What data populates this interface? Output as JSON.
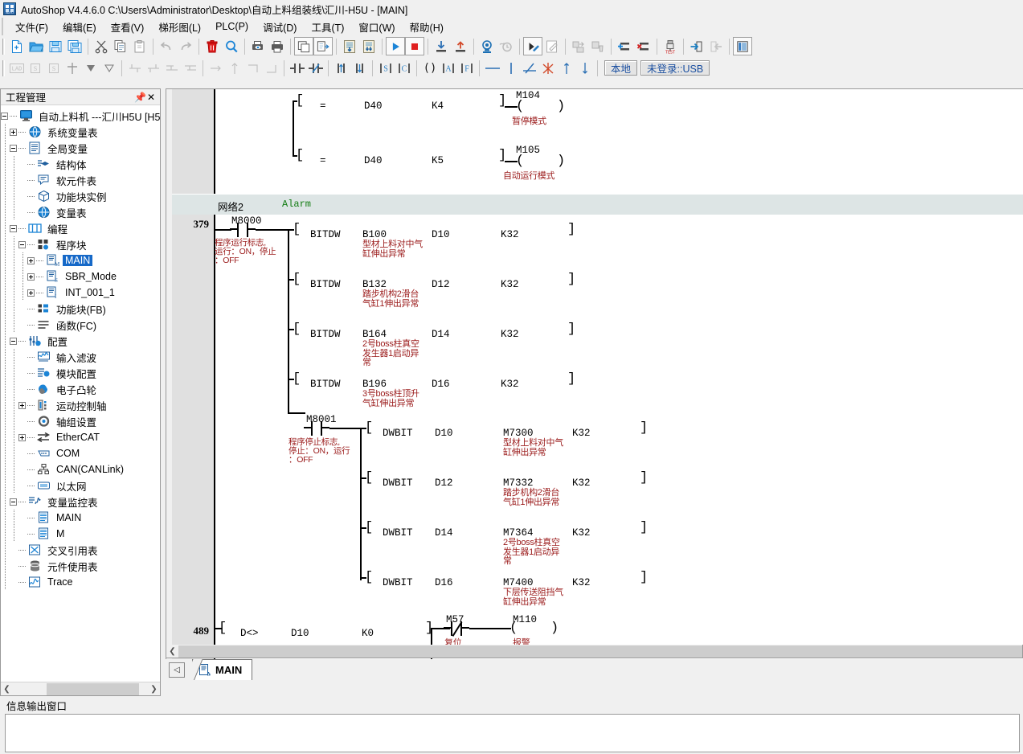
{
  "window": {
    "app_name": "AutoShop V4.4.6.0",
    "path": "C:\\Users\\Administrator\\Desktop\\自动上料组装线\\汇川-H5U - [MAIN]",
    "title": "AutoShop V4.4.6.0  C:\\Users\\Administrator\\Desktop\\自动上料组装线\\汇川-H5U - [MAIN]",
    "icon": "autoshop-logo"
  },
  "menubar": {
    "items": [
      {
        "label": "文件(F)"
      },
      {
        "label": "编辑(E)"
      },
      {
        "label": "查看(V)"
      },
      {
        "label": "梯形图(L)"
      },
      {
        "label": "PLC(P)"
      },
      {
        "label": "调试(D)"
      },
      {
        "label": "工具(T)"
      },
      {
        "label": "窗口(W)"
      },
      {
        "label": "帮助(H)"
      }
    ]
  },
  "toolbar_main": {
    "icons": [
      "new-file-icon",
      "open-folder-icon",
      "save-icon",
      "save-all-icon",
      "cut-icon",
      "copy-icon",
      "paste-icon",
      "undo-icon",
      "redo-icon",
      "delete-icon",
      "find-icon",
      "print-preview-icon",
      "print-icon",
      "compile-icon",
      "compile-all-icon",
      "download-to-plc-icon",
      "upload-from-plc-icon",
      "run-icon",
      "stop-icon",
      "download-icon",
      "upload-icon",
      "monitor-icon",
      "monitor-clock-icon",
      "edit-monitor-icon",
      "write-edit-icon",
      "force-icon",
      "force-clear-icon",
      "insert-row-icon",
      "delete-row-icon",
      "test-usb-icon",
      "login-icon",
      "logout-icon",
      "panel-icon"
    ]
  },
  "toolbar_ladder": {
    "icons": [
      "lad-icon",
      "stl-icon",
      "sfc-icon",
      "cursor-icon",
      "down-arrow-icon",
      "down-triangle-icon",
      "branch-up-icon",
      "branch-down-icon",
      "branch-left-icon",
      "branch-right-icon",
      "line-right-icon",
      "line-up-icon",
      "corner-icon",
      "corner2-icon",
      "no-contact-icon",
      "nc-contact-icon",
      "rising-edge-icon",
      "falling-edge-icon",
      "set-icon",
      "reset-icon",
      "coil-icon",
      "application-instruction-icon",
      "function-icon",
      "hline-icon",
      "vline-icon",
      "del-hline-icon",
      "del-vline-icon",
      "up-icon",
      "down-icon"
    ],
    "status_local": "本地",
    "status_login": "未登录::USB"
  },
  "project_panel": {
    "title": "工程管理",
    "pin_icon": "pin-icon",
    "close_icon": "close-icon",
    "tree": [
      {
        "label": "自动上料机 ---汇川H5U [H5",
        "icon": "plc-device-icon",
        "indent": 0,
        "toggle": "minus"
      },
      {
        "label": "系统变量表",
        "icon": "globe-icon",
        "indent": 1,
        "toggle": "plus"
      },
      {
        "label": "全局变量",
        "icon": "list-icon",
        "indent": 1,
        "toggle": "minus"
      },
      {
        "label": "结构体",
        "icon": "struct-icon",
        "indent": 2,
        "toggle": "none"
      },
      {
        "label": "软元件表",
        "icon": "device-table-icon",
        "indent": 2,
        "toggle": "none"
      },
      {
        "label": "功能块实例",
        "icon": "cube-icon",
        "indent": 2,
        "toggle": "none"
      },
      {
        "label": "变量表",
        "icon": "globe-icon",
        "indent": 2,
        "toggle": "none"
      },
      {
        "label": "编程",
        "icon": "contact-icon",
        "indent": 1,
        "toggle": "minus"
      },
      {
        "label": "程序块",
        "icon": "blocks-icon",
        "indent": 2,
        "toggle": "minus"
      },
      {
        "label": "MAIN",
        "icon": "main-prog-icon",
        "indent": 3,
        "toggle": "plus",
        "selected": true
      },
      {
        "label": "SBR_Mode",
        "icon": "sbr-prog-icon",
        "indent": 3,
        "toggle": "plus"
      },
      {
        "label": "INT_001_1",
        "icon": "int-prog-icon",
        "indent": 3,
        "toggle": "plus"
      },
      {
        "label": "功能块(FB)",
        "icon": "fb-icon",
        "indent": 2,
        "toggle": "none"
      },
      {
        "label": "函数(FC)",
        "icon": "fc-icon",
        "indent": 2,
        "toggle": "none"
      },
      {
        "label": "配置",
        "icon": "config-icon",
        "indent": 1,
        "toggle": "minus"
      },
      {
        "label": "输入滤波",
        "icon": "input-filter-icon",
        "indent": 2,
        "toggle": "none"
      },
      {
        "label": "模块配置",
        "icon": "module-config-icon",
        "indent": 2,
        "toggle": "none"
      },
      {
        "label": "电子凸轮",
        "icon": "cam-icon",
        "indent": 2,
        "toggle": "none"
      },
      {
        "label": "运动控制轴",
        "icon": "axis-icon",
        "indent": 2,
        "toggle": "plus"
      },
      {
        "label": "轴组设置",
        "icon": "gear-icon",
        "indent": 2,
        "toggle": "none"
      },
      {
        "label": "EtherCAT",
        "icon": "ethercat-icon",
        "indent": 2,
        "toggle": "plus"
      },
      {
        "label": "COM",
        "icon": "com-port-icon",
        "indent": 2,
        "toggle": "none"
      },
      {
        "label": "CAN(CANLink)",
        "icon": "can-icon",
        "indent": 2,
        "toggle": "none"
      },
      {
        "label": "以太网",
        "icon": "ethernet-icon",
        "indent": 2,
        "toggle": "none"
      },
      {
        "label": "变量监控表",
        "icon": "monitor-table-icon",
        "indent": 1,
        "toggle": "minus"
      },
      {
        "label": "MAIN",
        "icon": "table-icon",
        "indent": 2,
        "toggle": "none"
      },
      {
        "label": "M",
        "icon": "table-icon",
        "indent": 2,
        "toggle": "none"
      },
      {
        "label": "交叉引用表",
        "icon": "cross-ref-icon",
        "indent": 1,
        "toggle": "none"
      },
      {
        "label": "元件使用表",
        "icon": "element-usage-icon",
        "indent": 1,
        "toggle": "none"
      },
      {
        "label": "Trace",
        "icon": "trace-icon",
        "indent": 1,
        "toggle": "none"
      }
    ]
  },
  "ladder": {
    "network_header": {
      "label": "网络2",
      "comment": "Alarm"
    },
    "rung_numbers": [
      "379",
      "489"
    ],
    "rung_top": {
      "branches": [
        {
          "instr": "=",
          "op1": "D40",
          "op2": "K4",
          "coil": "M104",
          "coil_comment": "暂停模式"
        },
        {
          "instr": "=",
          "op1": "D40",
          "op2": "K5",
          "coil": "M105",
          "coil_comment": "自动运行模式"
        }
      ]
    },
    "rung_379": {
      "number": "379",
      "contact": "M8000",
      "contact_comment": "程序运行标志,\n运行：ON，停止\n：OFF",
      "branches": [
        {
          "instr": "BITDW",
          "op1": "B100",
          "op2": "D10",
          "op3": "K32",
          "comment": "型材上料对中气\n缸伸出异常"
        },
        {
          "instr": "BITDW",
          "op1": "B132",
          "op2": "D12",
          "op3": "K32",
          "comment": "踏步机构2滑台\n气缸1伸出异常"
        },
        {
          "instr": "BITDW",
          "op1": "B164",
          "op2": "D14",
          "op3": "K32",
          "comment": "2号boss柱真空\n发生器1启动异\n常"
        },
        {
          "instr": "BITDW",
          "op1": "B196",
          "op2": "D16",
          "op3": "K32",
          "comment": "3号boss柱顶升\n气缸伸出异常"
        }
      ]
    },
    "rung_m8001": {
      "contact": "M8001",
      "contact_comment": "程序停止标志,\n停止：ON，运行\n：OFF",
      "branches": [
        {
          "instr": "DWBIT",
          "op1": "D10",
          "op2": "M7300",
          "op3": "K32",
          "comment": "型材上料对中气\n缸伸出异常"
        },
        {
          "instr": "DWBIT",
          "op1": "D12",
          "op2": "M7332",
          "op3": "K32",
          "comment": "踏步机构2滑台\n气缸1伸出异常"
        },
        {
          "instr": "DWBIT",
          "op1": "D14",
          "op2": "M7364",
          "op3": "K32",
          "comment": "2号boss柱真空\n发生器1启动异\n常"
        },
        {
          "instr": "DWBIT",
          "op1": "D16",
          "op2": "M7400",
          "op3": "K32",
          "comment": "下层传送阻挡气\n缸伸出异常"
        }
      ]
    },
    "rung_489": {
      "number": "489",
      "instr": "D<>",
      "op1": "D10",
      "op2": "K0",
      "contact_nc": "M57",
      "contact_nc_comment": "复位",
      "coil": "M110",
      "coil_comment": "报警"
    }
  },
  "tabs": {
    "nav_icon": "tab-nav-left-icon",
    "items": [
      {
        "label": "MAIN",
        "icon": "main-prog-icon",
        "active": true
      }
    ]
  },
  "output_window": {
    "title": "信息输出窗口",
    "content": ""
  },
  "colors": {
    "comment_red": "#9b1b1b",
    "network_comment_green": "#127c12",
    "selection_blue": "#1669c8",
    "status_text_blue": "#1b4fa0",
    "network_bar": "#dde5e5",
    "gutter_gray": "#e0e0e0"
  }
}
